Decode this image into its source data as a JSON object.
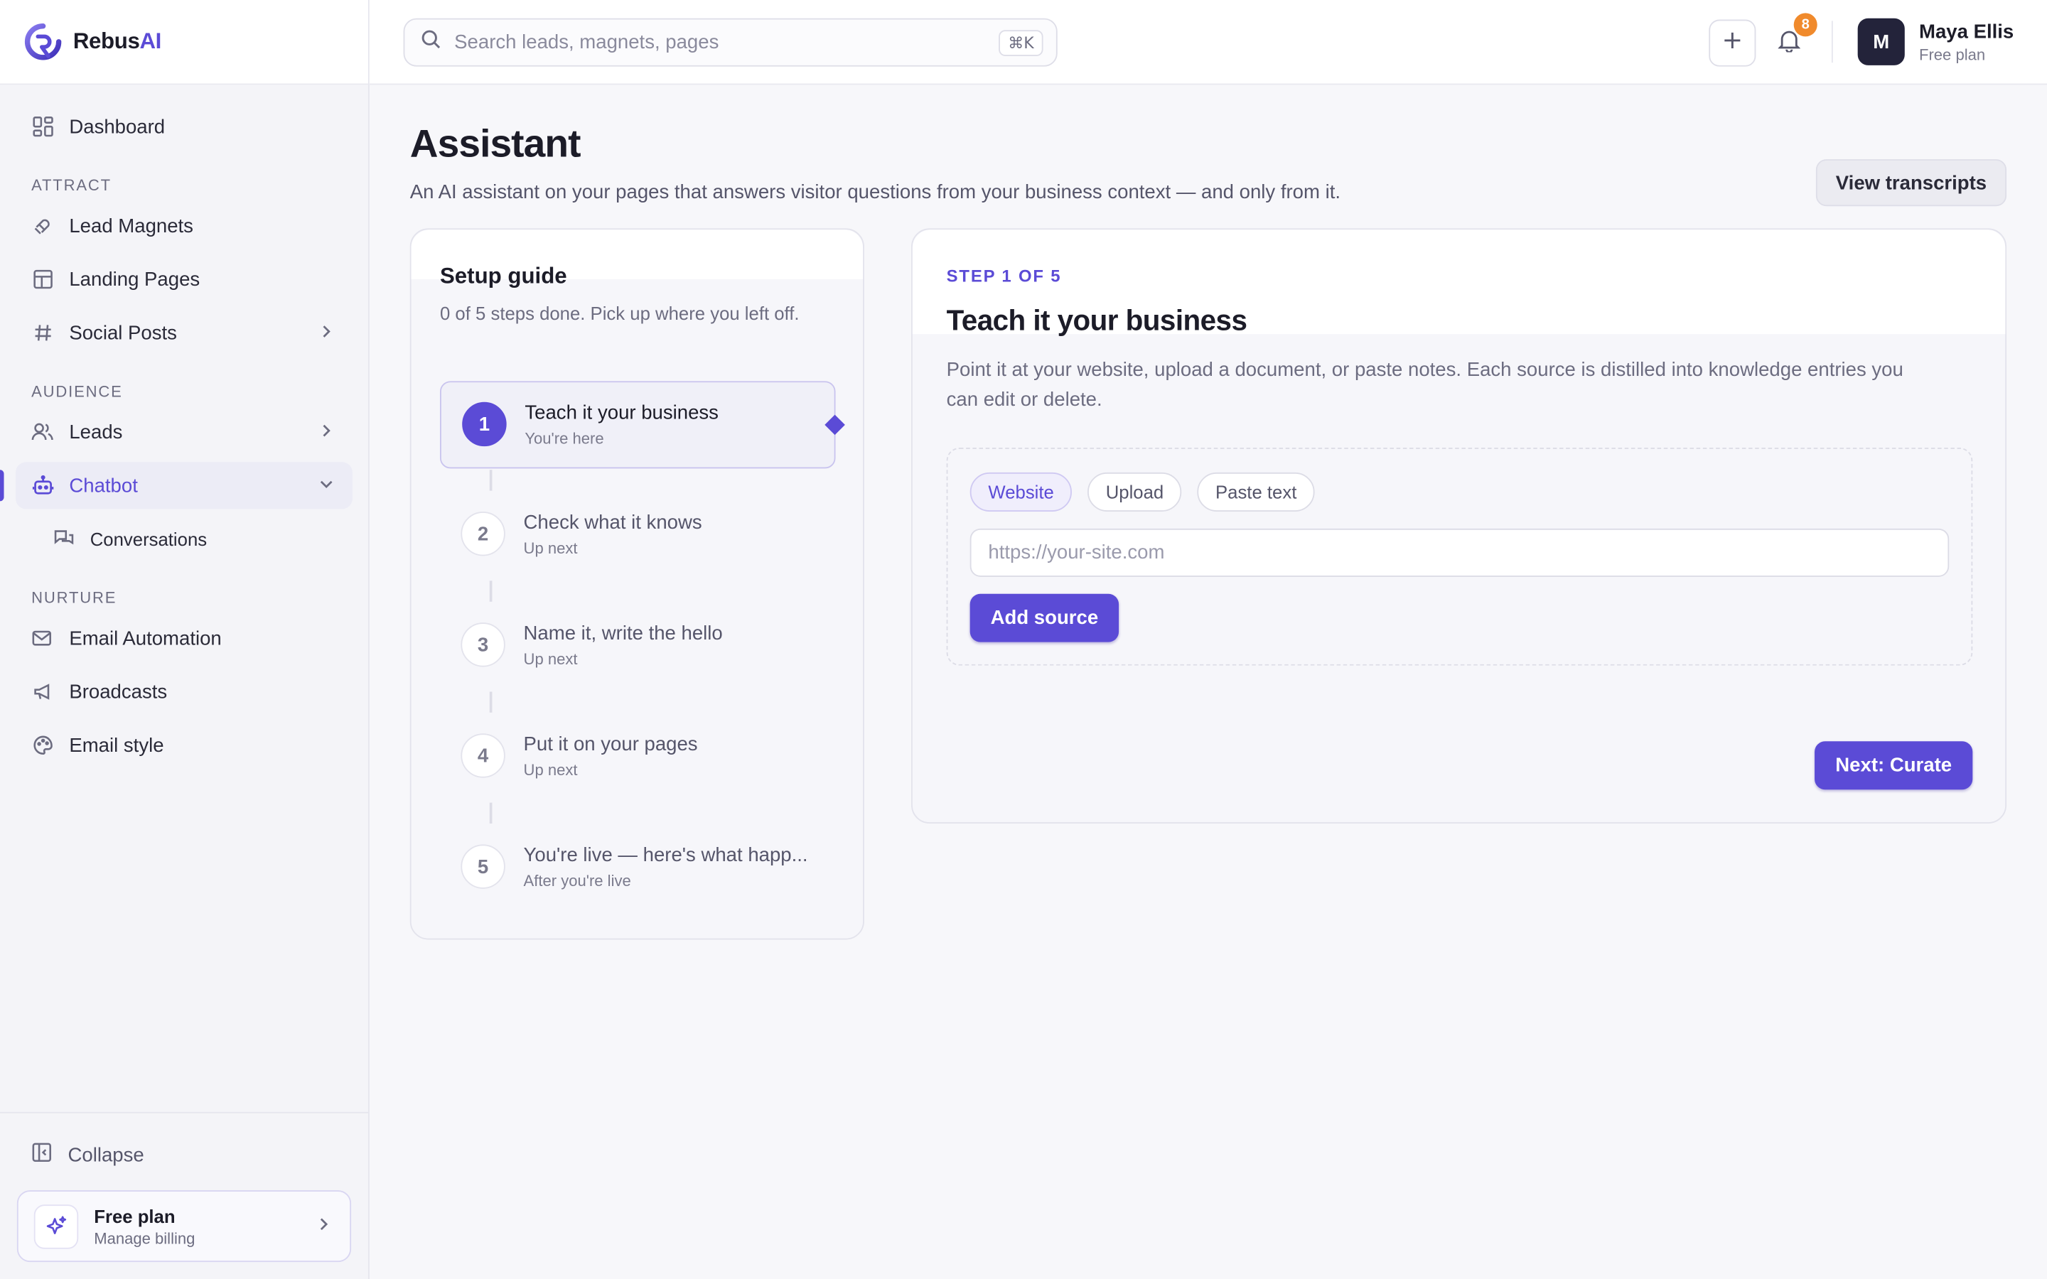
{
  "brand": {
    "name": "Rebus",
    "name_accent": "AI"
  },
  "sidebar": {
    "dashboard": "Dashboard",
    "sections": {
      "attract": "ATTRACT",
      "audience": "AUDIENCE",
      "nurture": "NURTURE"
    },
    "items": {
      "lead_magnets": "Lead Magnets",
      "landing_pages": "Landing Pages",
      "social_posts": "Social Posts",
      "leads": "Leads",
      "chatbot": "Chatbot",
      "conversations": "Conversations",
      "email_automation": "Email Automation",
      "broadcasts": "Broadcasts",
      "email_style": "Email style"
    },
    "collapse": "Collapse",
    "plan": {
      "title": "Free plan",
      "subtitle": "Manage billing"
    }
  },
  "topbar": {
    "search_placeholder": "Search leads, magnets, pages",
    "shortcut": "⌘K",
    "notification_count": "8",
    "user": {
      "initial": "M",
      "name": "Maya Ellis",
      "plan": "Free plan"
    }
  },
  "page": {
    "title": "Assistant",
    "subtitle": "An AI assistant on your pages that answers visitor questions from your business context — and only from it.",
    "view_transcripts": "View transcripts"
  },
  "guide": {
    "title": "Setup guide",
    "subtitle": "0 of 5 steps done. Pick up where you left off.",
    "steps": [
      {
        "num": "1",
        "title": "Teach it your business",
        "meta": "You're here"
      },
      {
        "num": "2",
        "title": "Check what it knows",
        "meta": "Up next"
      },
      {
        "num": "3",
        "title": "Name it, write the hello",
        "meta": "Up next"
      },
      {
        "num": "4",
        "title": "Put it on your pages",
        "meta": "Up next"
      },
      {
        "num": "5",
        "title": "You're live — here's what happ...",
        "meta": "After you're live"
      }
    ]
  },
  "panel": {
    "step_label": "STEP 1 OF 5",
    "title": "Teach it your business",
    "description": "Point it at your website, upload a document, or paste notes. Each source is distilled into knowledge entries you can edit or delete.",
    "tabs": [
      "Website",
      "Upload",
      "Paste text"
    ],
    "url_placeholder": "https://your-site.com",
    "add_source": "Add source",
    "next": "Next: Curate"
  },
  "colors": {
    "accent": "#5b4bd6",
    "badge": "#f08a2c"
  }
}
